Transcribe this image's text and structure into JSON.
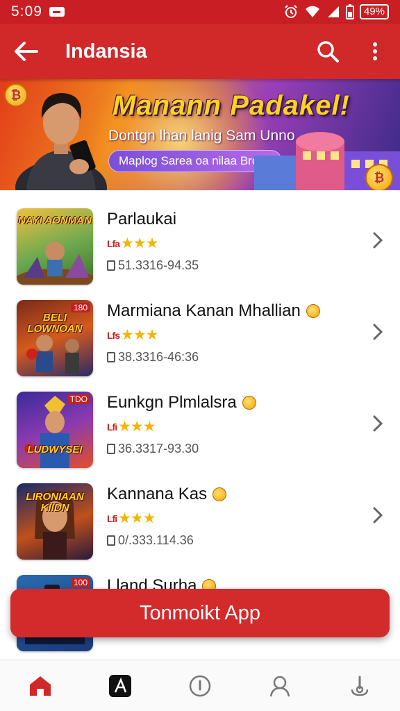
{
  "status_bar": {
    "time": "5:09",
    "battery": "49%",
    "icons": [
      "notification-icon",
      "alarm-icon",
      "wifi-icon",
      "signal-icon",
      "battery-icon"
    ]
  },
  "app_bar": {
    "title": "Indansia",
    "icons": [
      "back-arrow-icon",
      "search-icon",
      "more-vert-icon"
    ]
  },
  "banner": {
    "title": "Manann Padakel!",
    "subtitle": "Dontgn lhan lanig Sam Unno",
    "pill": "Maplog Sarea oa nilaa Broaa"
  },
  "apps": [
    {
      "name": "Parlaukai",
      "rating_tag": "Lfa",
      "stars": 3,
      "meta": "51.3316-94.35",
      "thumb_text": "NAYI AONMAN",
      "thumb_badge": ""
    },
    {
      "name": "Marmiana Kanan Mhallian",
      "rating_tag": "Lfs",
      "stars": 3,
      "meta": "38.3316-46:36",
      "thumb_text": "BELI LOWNOAN",
      "thumb_badge": "180"
    },
    {
      "name": "Eunkgn Plmlalsra",
      "rating_tag": "Lfi",
      "stars": 3,
      "meta": "36.3317-93.30",
      "thumb_text": "LUDWYSEI",
      "thumb_badge": "TDO"
    },
    {
      "name": "Kannana Kas",
      "rating_tag": "Lfi",
      "stars": 3,
      "meta": "0/.333.114.36",
      "thumb_text": "LIRONIAAN KIIDN",
      "thumb_badge": ""
    },
    {
      "name": "Lland Surha",
      "rating_tag": "",
      "stars": 0,
      "meta": "",
      "thumb_text": "",
      "thumb_badge": "100"
    }
  ],
  "install_button": {
    "label": "Tonmoikt App"
  },
  "bottom_nav": {
    "items": [
      "home-icon",
      "app-store-icon",
      "info-icon",
      "profile-icon",
      "download-icon"
    ],
    "active": "home-icon"
  },
  "colors": {
    "primary": "#d1282a",
    "status_bar": "#c91f24",
    "star": "#f5b400"
  }
}
